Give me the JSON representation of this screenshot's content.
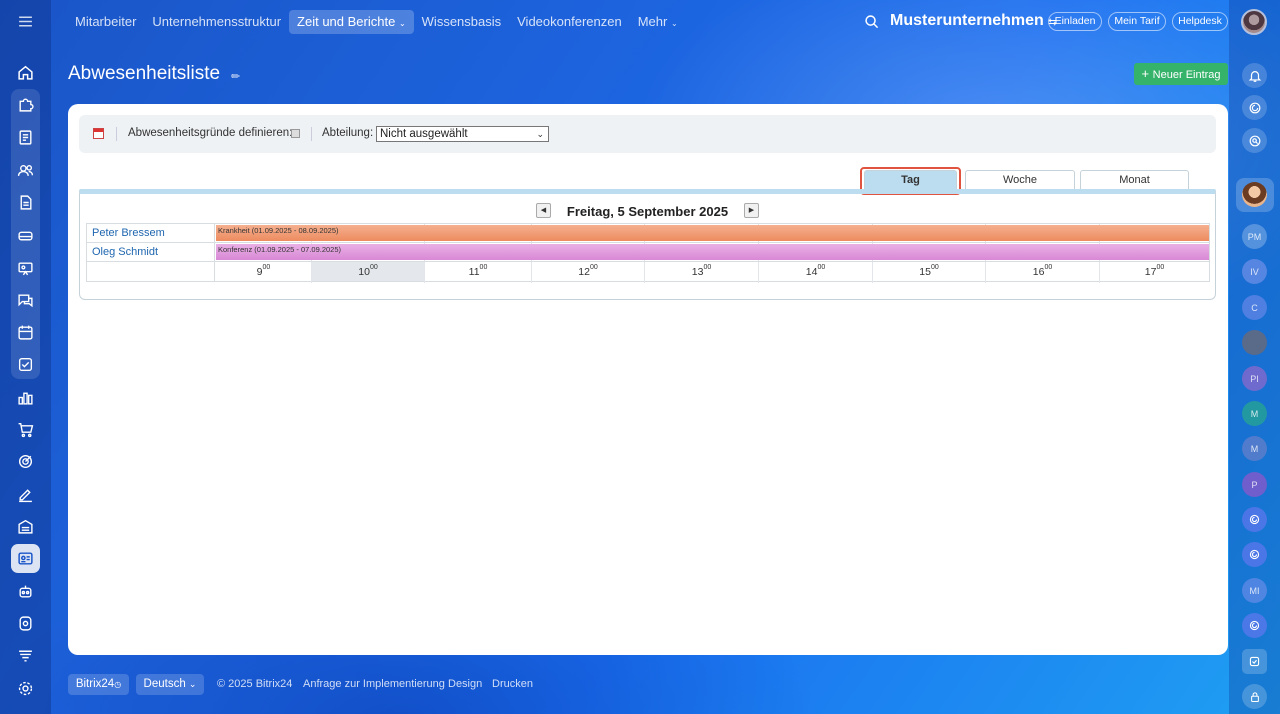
{
  "topnav": {
    "items": [
      "Mitarbeiter",
      "Unternehmensstruktur",
      "Zeit und Berichte",
      "Wissensbasis",
      "Videokonferenzen",
      "Mehr"
    ],
    "active": "Zeit und Berichte",
    "company": "Musterunternehmen",
    "buttons": {
      "invite": "Einladen",
      "tariff": "Mein Tarif",
      "helpdesk": "Helpdesk"
    }
  },
  "page": {
    "title": "Abwesenheitsliste",
    "new_entry": "Neuer Eintrag"
  },
  "filter": {
    "reasons_label": "Abwesenheitsgründe definieren:",
    "department_label": "Abteilung:",
    "department_value": "Nicht ausgewählt"
  },
  "tabs": {
    "day": "Tag",
    "week": "Woche",
    "month": "Monat",
    "active": "Tag"
  },
  "calendar": {
    "date": "Freitag, 5 September 2025",
    "rows": [
      {
        "name": "Peter Bressem",
        "absence": "Krankheit (01.09.2025 - 08.09.2025)"
      },
      {
        "name": "Oleg Schmidt",
        "absence": "Konferenz (01.09.2025 - 07.09.2025)"
      }
    ],
    "hours": [
      "9",
      "10",
      "11",
      "12",
      "13",
      "14",
      "15",
      "16",
      "17"
    ],
    "minutes": "00",
    "current_hour": "10"
  },
  "rightbar": {
    "initials": [
      "PM",
      "IV",
      "C",
      "PI",
      "M",
      "M",
      "P",
      "MI"
    ]
  },
  "footer": {
    "brand": "Bitrix24",
    "language": "Deutsch",
    "copyright": "© 2025 Bitrix24",
    "links": [
      "Anfrage zur Implementierung",
      "Design",
      "Drucken"
    ]
  }
}
